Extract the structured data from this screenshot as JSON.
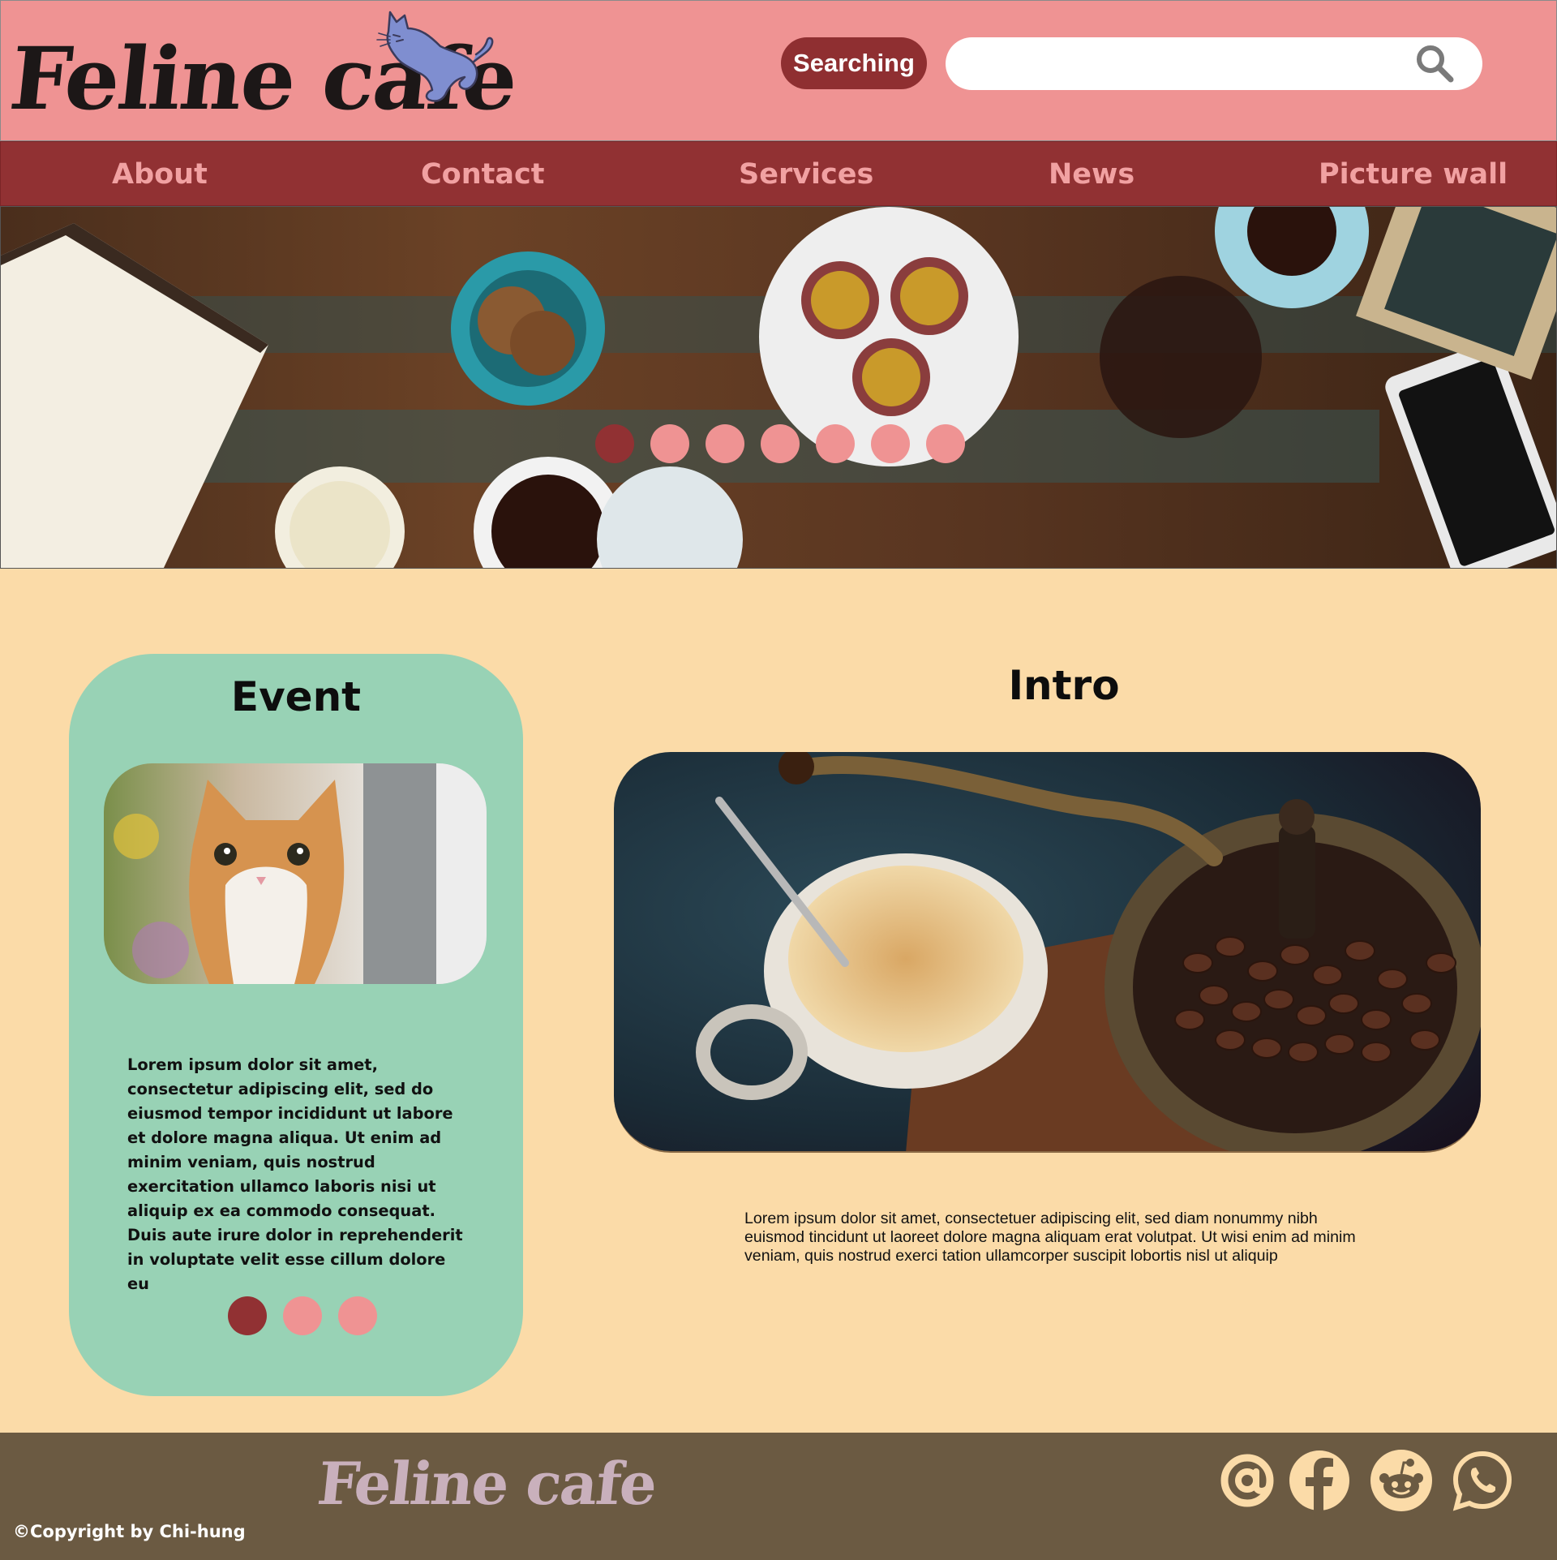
{
  "header": {
    "logo_text": "Feline cafe",
    "search_button_label": "Searching",
    "search_placeholder": "",
    "search_value": ""
  },
  "nav": {
    "items": [
      {
        "label": "About"
      },
      {
        "label": "Contact"
      },
      {
        "label": "Services"
      },
      {
        "label": "News"
      },
      {
        "label": "Picture wall"
      }
    ]
  },
  "hero": {
    "slide_count": 7,
    "active_slide": 1
  },
  "event": {
    "title": "Event",
    "text": "Lorem ipsum dolor sit amet, consectetur adipiscing elit, sed do eiusmod tempor incididunt ut labore et dolore magna aliqua. Ut enim ad minim veniam, quis nostrud exercitation ullamco laboris nisi ut aliquip ex ea commodo consequat. Duis aute irure dolor in reprehenderit in voluptate velit esse cillum dolore eu",
    "slide_count": 3,
    "active_slide": 1
  },
  "intro": {
    "title": "Intro",
    "text": "Lorem ipsum dolor sit amet, consectetuer adipiscing elit, sed diam nonummy nibh euismod tincidunt ut laoreet dolore magna aliquam erat volutpat. Ut wisi enim ad minim veniam, quis nostrud exerci tation ullamcorper suscipit lobortis nisl ut aliquip"
  },
  "footer": {
    "logo_text": "Feline cafe",
    "copyright": "©Copyright by Chi-hung",
    "social_icons": [
      "email-at-icon",
      "facebook-icon",
      "reddit-icon",
      "whatsapp-icon"
    ]
  },
  "colors": {
    "header_bg": "#ef9393",
    "nav_bg": "#913133",
    "page_bg": "#fbdba8",
    "event_bg": "#98d2b5",
    "footer_bg": "#6b5a42",
    "accent": "#913133",
    "icon_cream": "#fbdba8"
  }
}
